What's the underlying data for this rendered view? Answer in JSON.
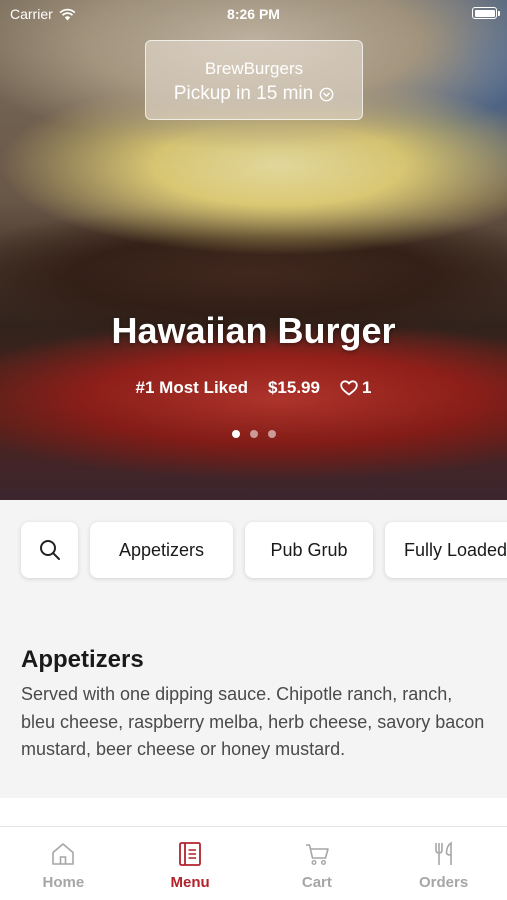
{
  "status_bar": {
    "carrier": "Carrier",
    "time": "8:26 PM"
  },
  "store": {
    "name": "BrewBurgers",
    "pickup": "Pickup in 15 min"
  },
  "featured": {
    "title": "Hawaiian Burger",
    "badge": "#1 Most Liked",
    "price": "$15.99",
    "likes": "1",
    "carousel_pages": 3,
    "carousel_active": 1
  },
  "categories": [
    "Appetizers",
    "Pub Grub",
    "Fully Loaded"
  ],
  "section": {
    "title": "Appetizers",
    "description": "Served with one dipping sauce. Chipotle ranch, ranch, bleu cheese, raspberry melba, herb cheese, savory bacon mustard, beer cheese or honey mustard."
  },
  "tabs": [
    {
      "label": "Home",
      "icon": "home-icon",
      "active": false
    },
    {
      "label": "Menu",
      "icon": "menu-icon",
      "active": true
    },
    {
      "label": "Cart",
      "icon": "cart-icon",
      "active": false
    },
    {
      "label": "Orders",
      "icon": "orders-icon",
      "active": false
    }
  ],
  "colors": {
    "accent": "#b3222b",
    "tab_inactive": "#a6a6a6",
    "background": "#f4f4f4"
  }
}
